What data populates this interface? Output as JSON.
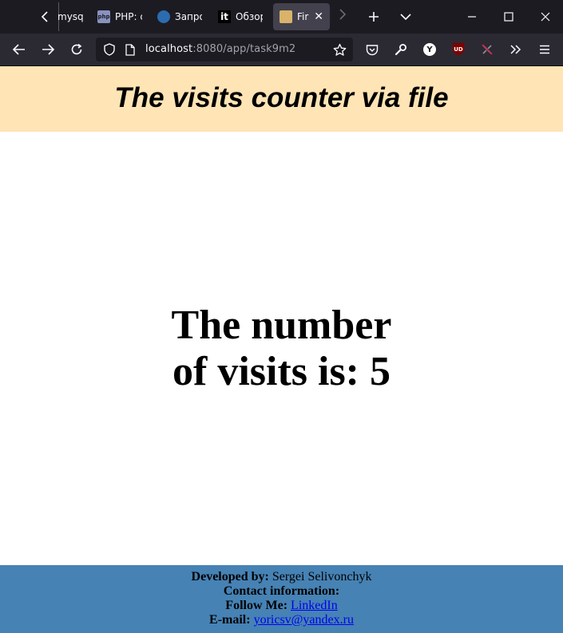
{
  "browser": {
    "tabs": [
      {
        "title": "mysql",
        "favicon": "mysql-icon"
      },
      {
        "title": "PHP: c",
        "favicon": "php-icon"
      },
      {
        "title": "Запро",
        "favicon": "globe-icon"
      },
      {
        "title": "Обзор",
        "favicon": "it-icon"
      },
      {
        "title": "First",
        "favicon": "page-icon",
        "active": true
      }
    ],
    "url_host": "localhost",
    "url_path": ":8080/app/task9m2"
  },
  "page": {
    "header_title": "The visits counter via file",
    "visits_line1": "The number",
    "visits_line2": "of visits is: 5"
  },
  "footer": {
    "developed_label": "Developed by:",
    "developer_name": "Sergei Selivonchyk",
    "contact_label": "Contact information:",
    "follow_label": "Follow Me:",
    "follow_link": "LinkedIn",
    "email_label": "E-mail:",
    "email_link": "yoricsv@yandex.ru"
  },
  "colors": {
    "header_bg": "#ffe4b5",
    "footer_bg": "#4682b4",
    "link": "#0000ee",
    "tabstrip_bg": "#1c1b22",
    "navbar_bg": "#2b2a33"
  }
}
